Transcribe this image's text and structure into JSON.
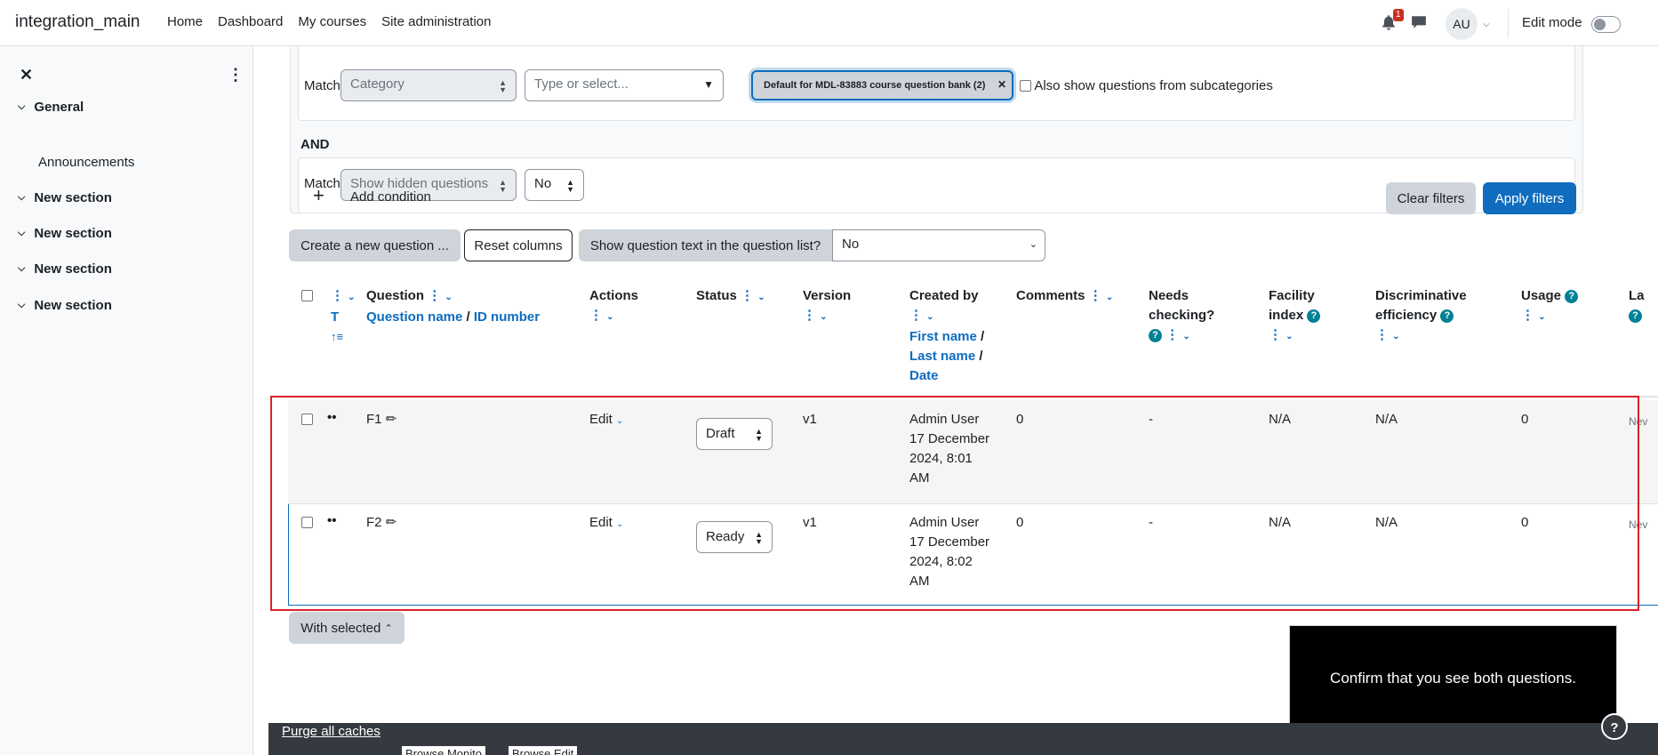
{
  "navbar": {
    "brand": "integration_main",
    "links": [
      "Home",
      "Dashboard",
      "My courses",
      "Site administration"
    ],
    "notification_count": "1",
    "avatar_initials": "AU",
    "edit_mode_label": "Edit mode"
  },
  "drawer": {
    "close_icon": "close-icon",
    "sections": [
      {
        "label": "General",
        "items": [
          "Announcements"
        ]
      },
      {
        "label": "New section"
      },
      {
        "label": "New section"
      },
      {
        "label": "New section"
      },
      {
        "label": "New section"
      }
    ]
  },
  "filters": {
    "row1": {
      "match_label": "Match",
      "type_select": "Category",
      "value_placeholder": "Type or select...",
      "selected_chip": "Default for MDL-83883 course question bank (2)",
      "subcategories_label": "Also show questions from subcategories"
    },
    "and_label": "AND",
    "row2": {
      "match_label": "Match",
      "type_select": "Show hidden questions",
      "value_select": "No"
    },
    "add_condition": "Add condition",
    "clear_filters": "Clear filters",
    "apply_filters": "Apply filters"
  },
  "toolbar": {
    "create_question": "Create a new question ...",
    "reset_columns": "Reset columns",
    "show_text_label": "Show question text in the question list?",
    "show_text_value": "No"
  },
  "table": {
    "headers": {
      "type_short": "T",
      "question": "Question",
      "question_name": "Question name",
      "id_number": "ID number",
      "actions": "Actions",
      "status": "Status",
      "version": "Version",
      "created_by": "Created by",
      "first_name": "First name",
      "last_name": "Last name",
      "date": "Date",
      "comments": "Comments",
      "needs_checking": "Needs checking?",
      "facility_index_1": "Facility",
      "facility_index_2": "index",
      "disc_eff_1": "Discriminative",
      "disc_eff_2": "efficiency",
      "usage": "Usage",
      "last_used": "La"
    },
    "rows": [
      {
        "name": "F1",
        "action": "Edit",
        "status": "Draft",
        "version": "v1",
        "created_by": "Admin User",
        "date_1": "17 December",
        "date_2": "2024, 8:01",
        "date_3": "AM",
        "comments": "0",
        "needs_checking": "-",
        "facility": "N/A",
        "discrimination": "N/A",
        "usage": "0",
        "last_used": "Nev"
      },
      {
        "name": "F2",
        "action": "Edit",
        "status": "Ready",
        "version": "v1",
        "created_by": "Admin User",
        "date_1": "17 December",
        "date_2": "2024, 8:02",
        "date_3": "AM",
        "comments": "0",
        "needs_checking": "-",
        "facility": "N/A",
        "discrimination": "N/A",
        "usage": "0",
        "last_used": "Nev"
      }
    ]
  },
  "with_selected": "With selected",
  "tooltip_text": "Confirm that you see both questions.",
  "footer": {
    "purge_caches": "Purge all caches",
    "btn1": "Browse Monito",
    "btn2": "Browse Edit"
  },
  "colors": {
    "accent": "#0f6cbf",
    "highlight_box": "#d9222a",
    "help_icon": "#008196"
  }
}
